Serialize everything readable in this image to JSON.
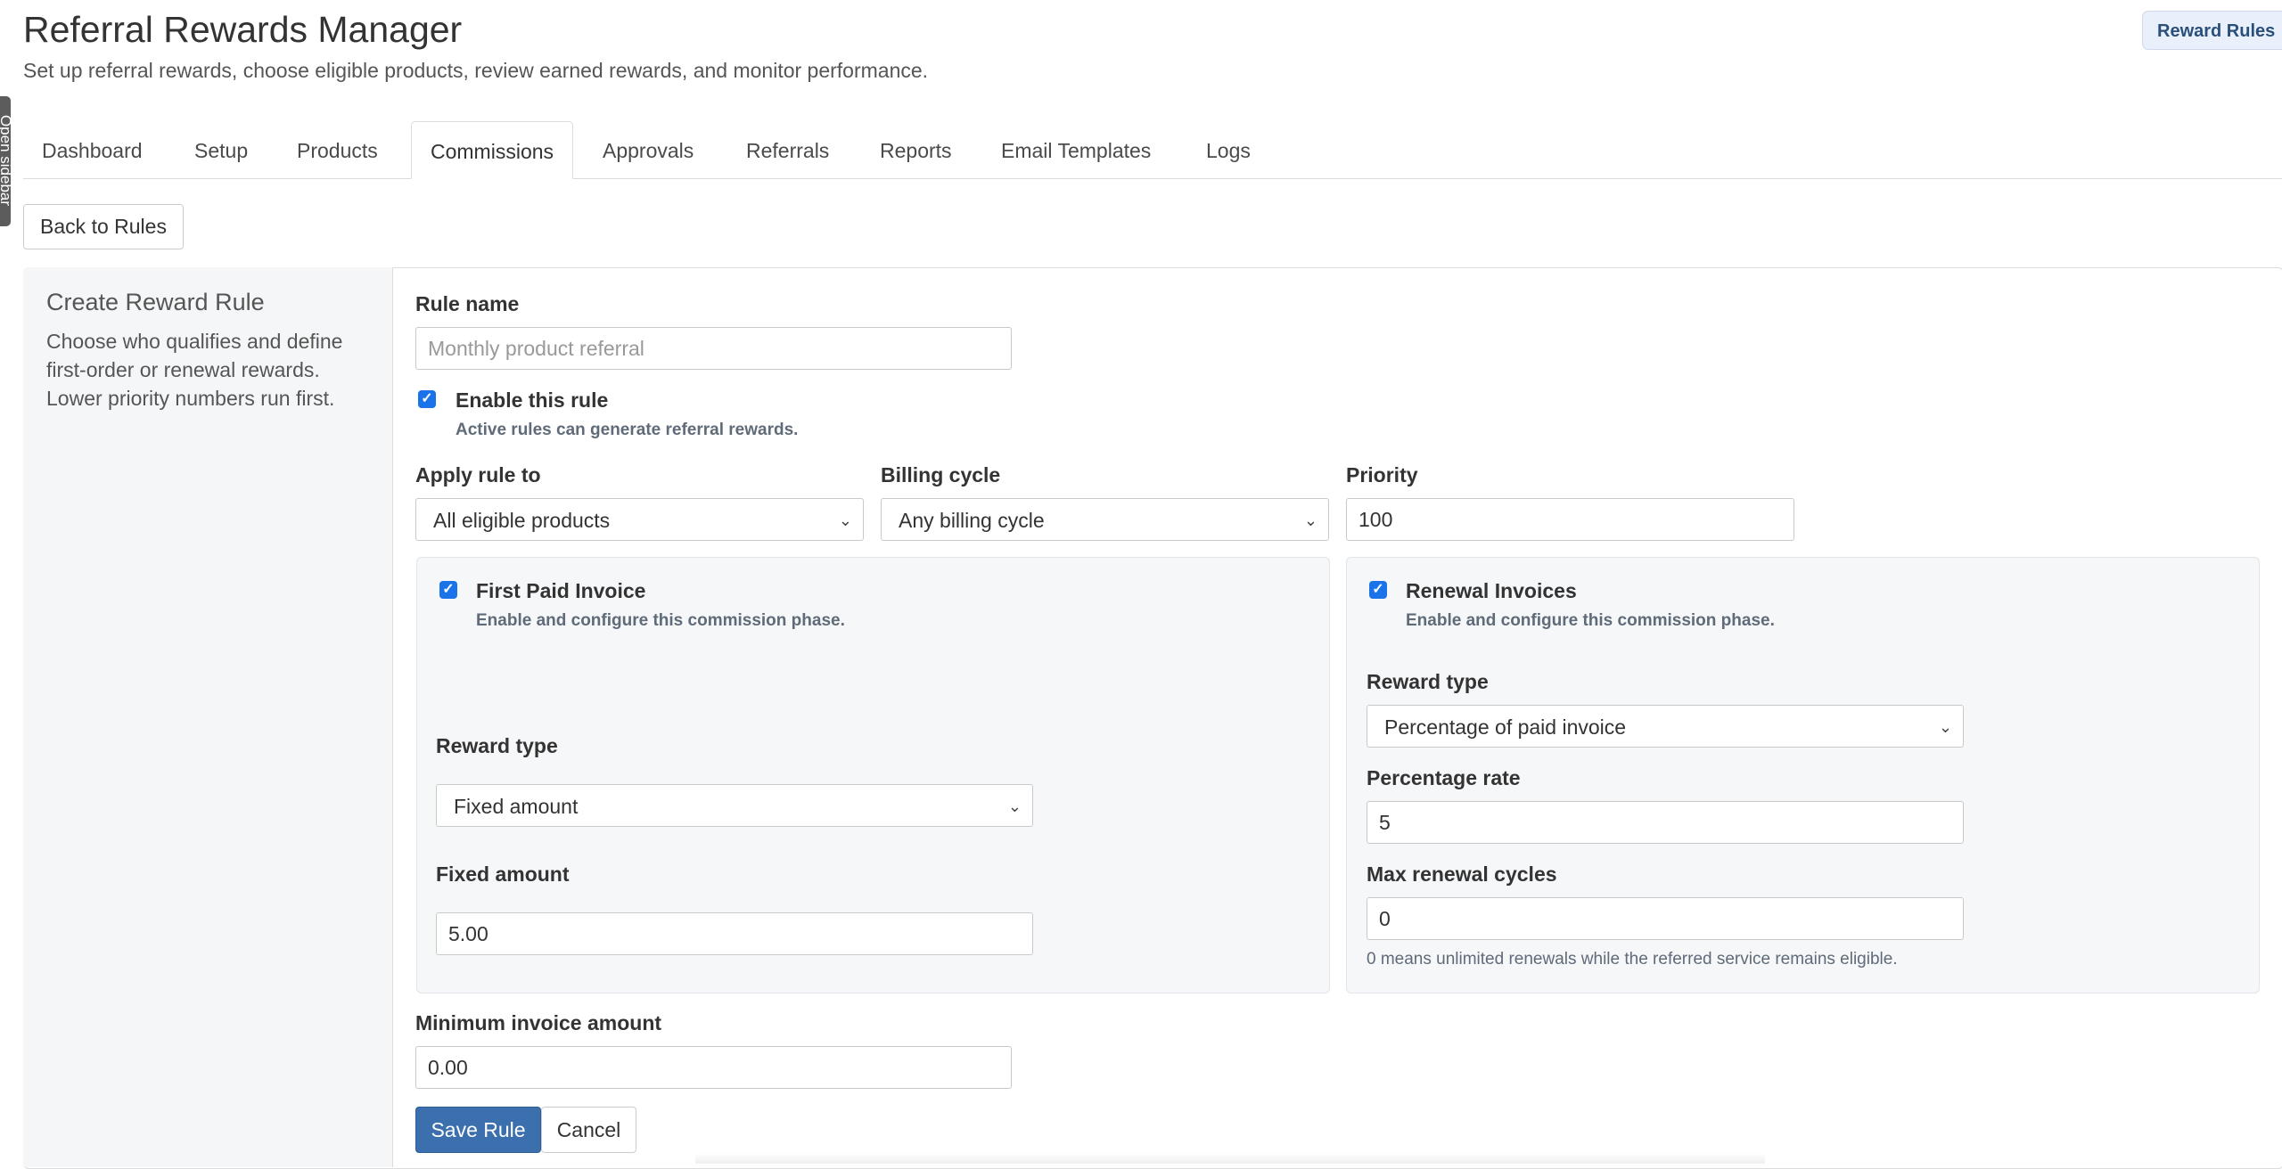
{
  "header": {
    "title": "Referral Rewards Manager",
    "subtitle": "Set up referral rewards, choose eligible products, review earned rewards, and monitor performance.",
    "badge": "Reward Rules"
  },
  "sidebar_toggle": {
    "label": "Open sidebar"
  },
  "tabs": [
    {
      "label": "Dashboard",
      "active": false
    },
    {
      "label": "Setup",
      "active": false
    },
    {
      "label": "Products",
      "active": false
    },
    {
      "label": "Commissions",
      "active": true
    },
    {
      "label": "Approvals",
      "active": false
    },
    {
      "label": "Referrals",
      "active": false
    },
    {
      "label": "Reports",
      "active": false
    },
    {
      "label": "Email Templates",
      "active": false
    },
    {
      "label": "Logs",
      "active": false
    }
  ],
  "back_button": "Back to Rules",
  "side_panel": {
    "title": "Create Reward Rule",
    "description": "Choose who qualifies and define first-order or renewal rewards. Lower priority numbers run first."
  },
  "form": {
    "rule_name": {
      "label": "Rule name",
      "value": "",
      "placeholder": "Monthly product referral"
    },
    "enable_rule": {
      "label": "Enable this rule",
      "help": "Active rules can generate referral rewards.",
      "checked": true
    },
    "apply_to": {
      "label": "Apply rule to",
      "value": "All eligible products"
    },
    "billing_cycle": {
      "label": "Billing cycle",
      "value": "Any billing cycle"
    },
    "priority": {
      "label": "Priority",
      "value": "100"
    },
    "first_invoice": {
      "title": "First Paid Invoice",
      "help": "Enable and configure this commission phase.",
      "checked": true,
      "reward_type_label": "Reward type",
      "reward_type_value": "Fixed amount",
      "amount_label": "Fixed amount",
      "amount_value": "5.00"
    },
    "renewal_invoices": {
      "title": "Renewal Invoices",
      "help": "Enable and configure this commission phase.",
      "checked": true,
      "reward_type_label": "Reward type",
      "reward_type_value": "Percentage of paid invoice",
      "rate_label": "Percentage rate",
      "rate_value": "5",
      "max_cycles_label": "Max renewal cycles",
      "max_cycles_value": "0",
      "max_cycles_help": "0 means unlimited renewals while the referred service remains eligible."
    },
    "min_invoice": {
      "label": "Minimum invoice amount",
      "value": "0.00"
    }
  },
  "actions": {
    "save": "Save Rule",
    "cancel": "Cancel"
  },
  "colors": {
    "primary": "#3b6fad",
    "checkbox": "#1a73e8",
    "panel_bg": "#f5f6f8",
    "badge_bg": "#e9f0fb"
  },
  "icons": {
    "select_arrow": "chevron-down-icon",
    "checkbox": "checkmark-icon"
  }
}
